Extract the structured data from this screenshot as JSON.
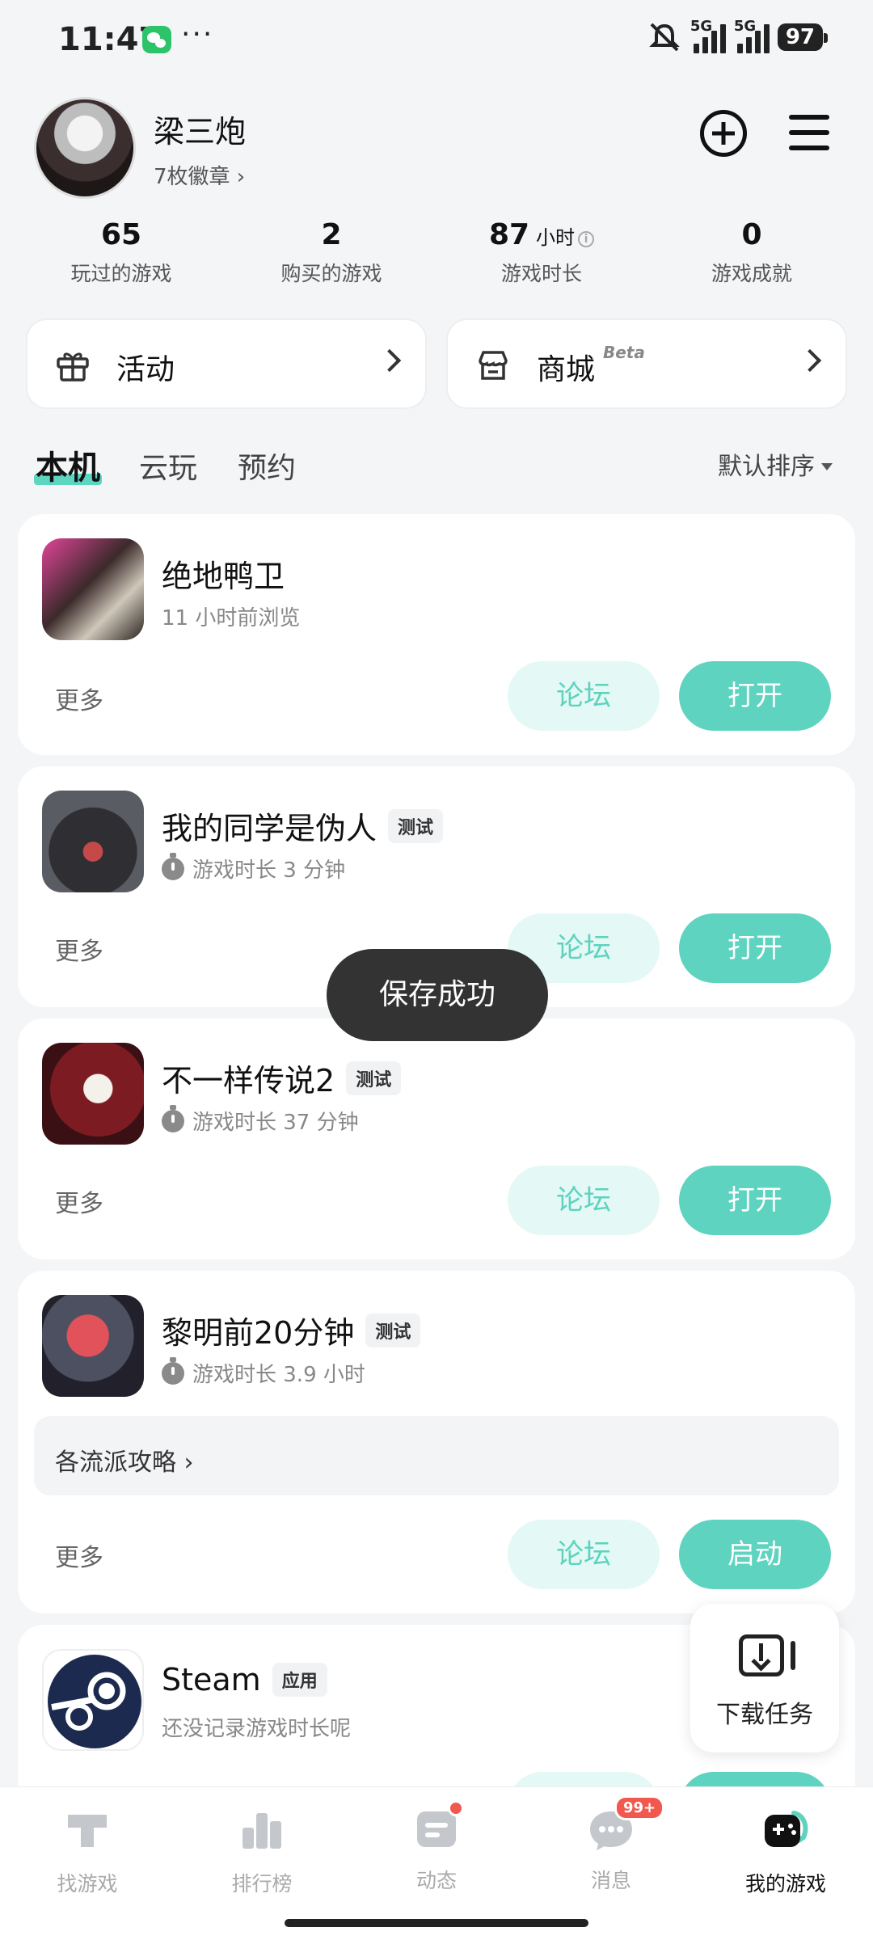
{
  "status_bar": {
    "time": "11:47",
    "dots": "···",
    "sim1": "5G",
    "sim2": "5G",
    "battery": "97"
  },
  "profile": {
    "username": "梁三炮",
    "badges": "7枚徽章 ›"
  },
  "stats": [
    {
      "num": "65",
      "label": "玩过的游戏"
    },
    {
      "num": "2",
      "label": "购买的游戏"
    },
    {
      "num": "87",
      "unit": "小时",
      "label": "游戏时长"
    },
    {
      "num": "0",
      "label": "游戏成就"
    }
  ],
  "quick": {
    "activity": "活动",
    "store": "商城",
    "beta": "Beta"
  },
  "tabs": {
    "local": "本机",
    "cloud": "云玩",
    "reserve": "预约",
    "sort": "默认排序"
  },
  "games": [
    {
      "name": "绝地鸭卫",
      "sub": "11 小时前浏览",
      "more": "更多",
      "forum": "论坛",
      "action": "打开"
    },
    {
      "name": "我的同学是伪人",
      "tag": "测试",
      "sub": "游戏时长 3 分钟",
      "more": "更多",
      "forum": "论坛",
      "action": "打开"
    },
    {
      "name": "不一样传说2",
      "tag": "测试",
      "sub": "游戏时长 37 分钟",
      "more": "更多",
      "forum": "论坛",
      "action": "打开"
    },
    {
      "name": "黎明前20分钟",
      "tag": "测试",
      "sub": "游戏时长 3.9 小时",
      "guide": "各流派攻略 ›",
      "more": "更多",
      "forum": "论坛",
      "action": "启动"
    },
    {
      "name": "Steam",
      "tag": "应用",
      "sub": "还没记录游戏时长呢"
    }
  ],
  "toast": "保存成功",
  "download": "下载任务",
  "nav": {
    "find": "找游戏",
    "rank": "排行榜",
    "feed": "动态",
    "msg": "消息",
    "msg_badge": "99+",
    "mine": "我的游戏"
  },
  "colors": {
    "accent": "#5ed3bf",
    "accent_light": "#e4f8f5",
    "badge_red": "#f1594f"
  }
}
